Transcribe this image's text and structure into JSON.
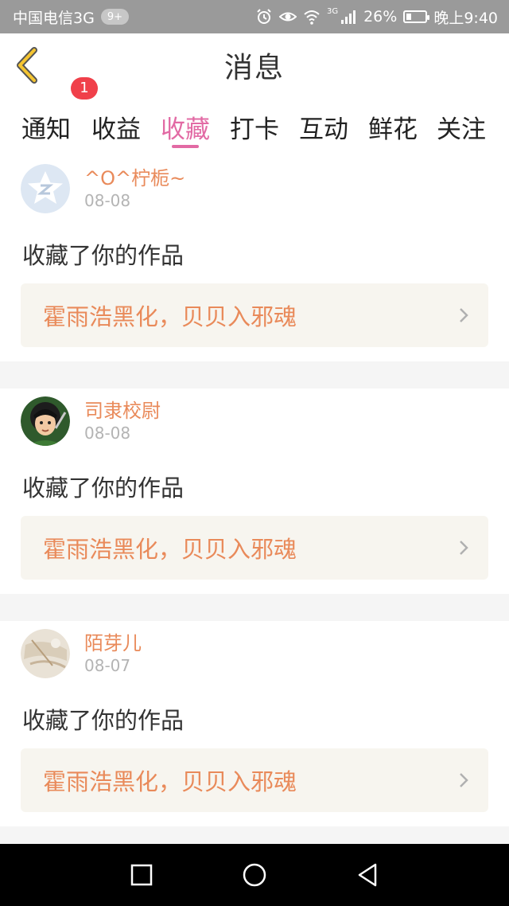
{
  "status_bar": {
    "carrier": "中国电信3G",
    "notification_badge": "9+",
    "network_label": "3G",
    "battery_percent_text": "26%",
    "battery_level": 0.26,
    "time": "晚上9:40"
  },
  "header": {
    "title": "消息"
  },
  "tabs": [
    {
      "label": "通知"
    },
    {
      "label": "收益",
      "badge": "1"
    },
    {
      "label": "收藏"
    },
    {
      "label": "打卡"
    },
    {
      "label": "互动"
    },
    {
      "label": "鲜花"
    },
    {
      "label": "关注"
    }
  ],
  "active_tab": "收藏",
  "items": [
    {
      "username": "^O^柠栀~",
      "date": "08-08",
      "action": "收藏了你的作品",
      "work_title": "霍雨浩黑化，贝贝入邪魂",
      "avatar": "qq-default-avatar"
    },
    {
      "username": "司隶校尉",
      "date": "08-08",
      "action": "收藏了你的作品",
      "work_title": "霍雨浩黑化，贝贝入邪魂",
      "avatar": "cartoon-warrior-avatar"
    },
    {
      "username": "陌芽儿",
      "date": "08-07",
      "action": "收藏了你的作品",
      "work_title": "霍雨浩黑化，贝贝入邪魂",
      "avatar": "photo-avatar"
    }
  ],
  "colors": {
    "accent_pink": "#e26aa4",
    "username_orange": "#e98a5a",
    "badge_red": "#f0404a"
  }
}
